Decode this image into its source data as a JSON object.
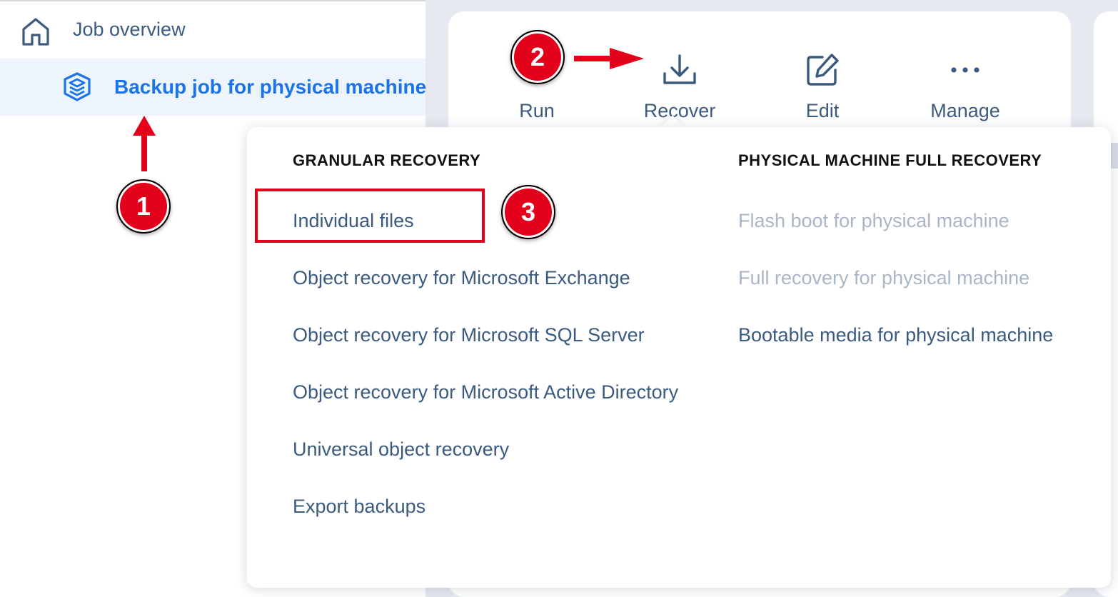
{
  "sidebar": {
    "home": {
      "label": "Job overview",
      "icon": "home-icon"
    },
    "job": {
      "label": "Backup job for physical machine",
      "icon": "backup-job-icon"
    }
  },
  "toolbar": {
    "run_label": "Run",
    "recover_label": "Recover",
    "edit_label": "Edit",
    "manage_label": "Manage"
  },
  "menu": {
    "granular_heading": "GRANULAR RECOVERY",
    "granular_items": [
      "Individual files",
      "Object recovery for Microsoft Exchange",
      "Object recovery for Microsoft SQL Server",
      "Object recovery for Microsoft Active Directory",
      "Universal object recovery",
      "Export backups"
    ],
    "full_heading": "PHYSICAL MACHINE FULL RECOVERY",
    "full_items": [
      {
        "label": "Flash boot for physical machine",
        "enabled": false
      },
      {
        "label": "Full recovery for physical machine",
        "enabled": false
      },
      {
        "label": "Bootable media for physical machine",
        "enabled": true
      }
    ]
  },
  "annotations": {
    "step1": "1",
    "step2": "2",
    "step3": "3"
  },
  "colors": {
    "accent": "#1a73e8",
    "text": "#3b5a80",
    "disabled": "#a9b6c6",
    "annotation_red": "#e3001b"
  }
}
